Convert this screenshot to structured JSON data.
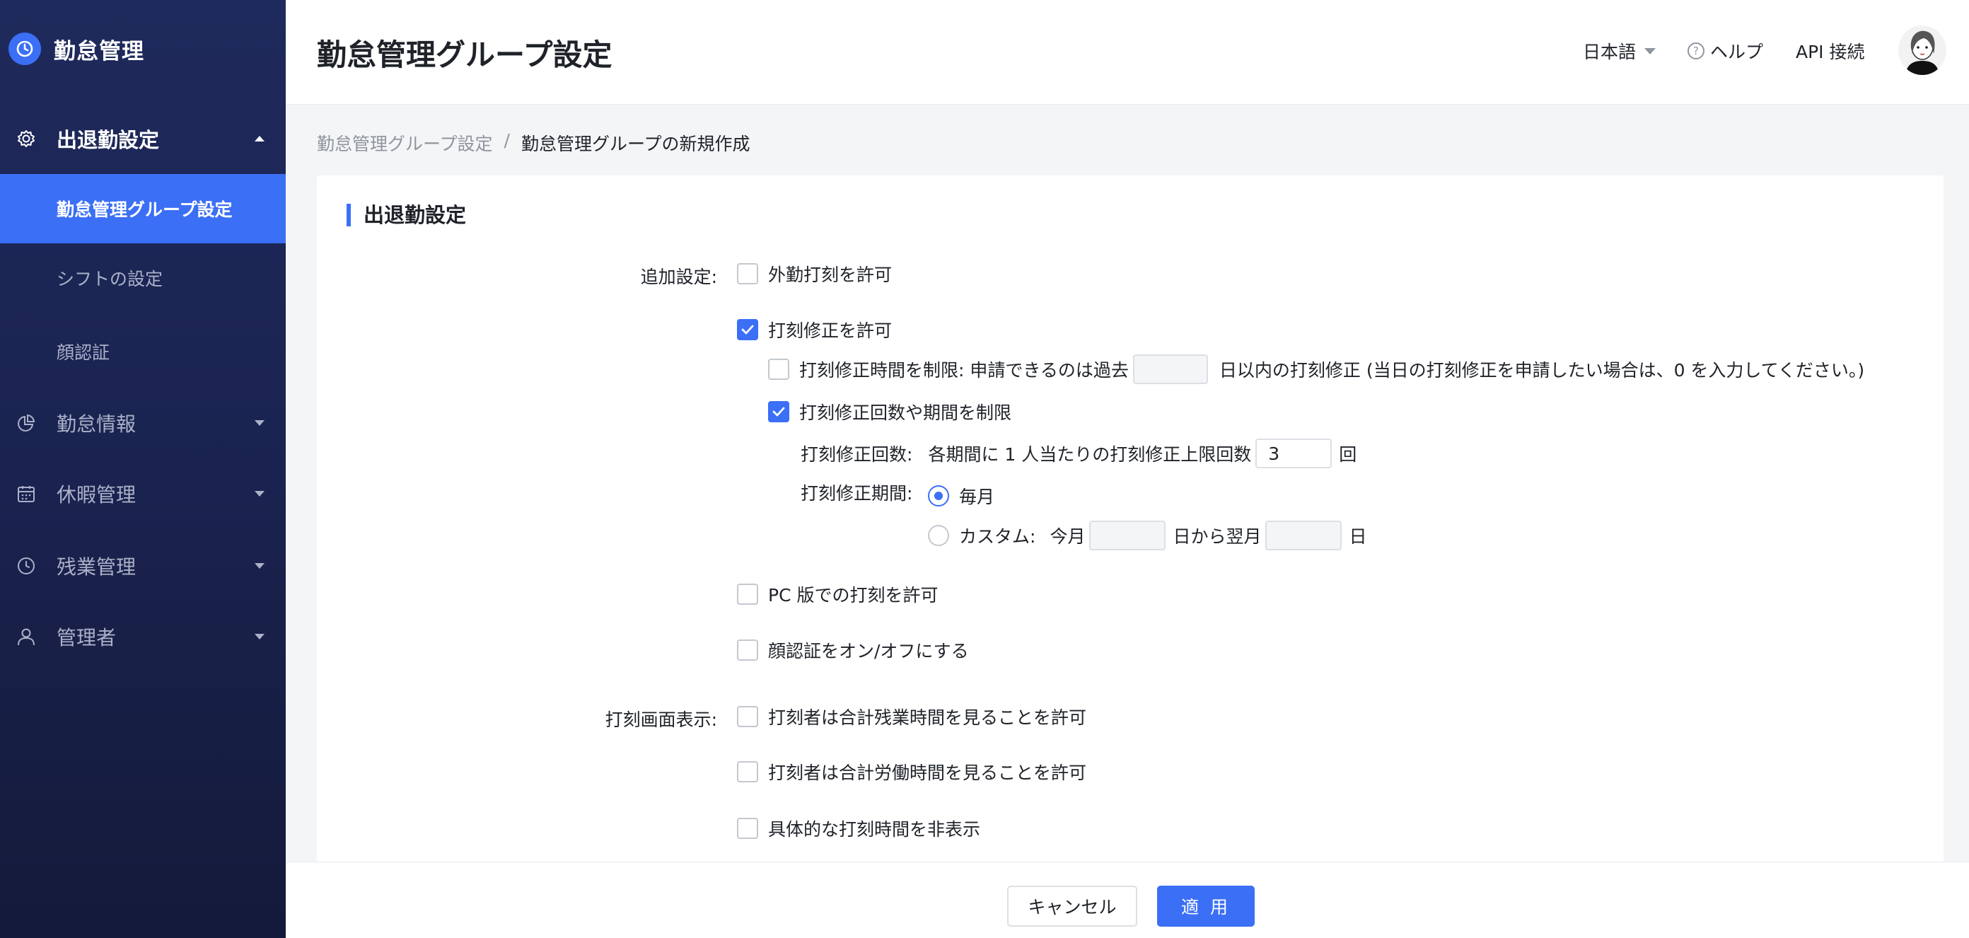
{
  "app": {
    "title": "勤怠管理"
  },
  "sidebar": {
    "groups": [
      {
        "label": "出退勤設定",
        "icon": "gear-icon",
        "open": true,
        "children": [
          "勤怠管理グループ設定",
          "シフトの設定",
          "顔認証"
        ]
      },
      {
        "label": "勤怠情報",
        "icon": "pie-chart-icon"
      },
      {
        "label": "休暇管理",
        "icon": "calendar-icon"
      },
      {
        "label": "残業管理",
        "icon": "clock-icon"
      },
      {
        "label": "管理者",
        "icon": "user-icon"
      }
    ],
    "active_child": "勤怠管理グループ設定"
  },
  "header": {
    "title": "勤怠管理グループ設定",
    "language": "日本語",
    "help": "ヘルプ",
    "api": "API 接続"
  },
  "breadcrumb": {
    "parent": "勤怠管理グループ設定",
    "separator": "/",
    "current": "勤怠管理グループの新規作成"
  },
  "form": {
    "section_title": "出退勤設定",
    "additional_label": "追加設定:",
    "allow_outside_clock": {
      "label": "外勤打刻を許可",
      "checked": false
    },
    "allow_correction": {
      "label": "打刻修正を許可",
      "checked": true
    },
    "limit_correction_time": {
      "label_prefix": "打刻修正時間を制限: 申請できるのは過去",
      "value": "",
      "label_suffix": "日以内の打刻修正 (当日の打刻修正を申請したい場合は、0 を入力してください。)",
      "checked": false
    },
    "limit_correction_count": {
      "label": "打刻修正回数や期間を制限",
      "checked": true
    },
    "correction_count": {
      "label": "打刻修正回数:",
      "text": "各期間に 1 人当たりの打刻修正上限回数",
      "value": "3",
      "unit": "回"
    },
    "correction_period": {
      "label": "打刻修正期間:",
      "monthly": {
        "label": "毎月",
        "selected": true
      },
      "custom": {
        "label": "カスタム:",
        "this_month": "今月",
        "start_value": "",
        "from_next": "日から翌月",
        "end_value": "",
        "day": "日",
        "selected": false
      }
    },
    "allow_pc_clock": {
      "label": "PC 版での打刻を許可",
      "checked": false
    },
    "face_toggle": {
      "label": "顔認証をオン/オフにする",
      "checked": false
    },
    "display_label": "打刻画面表示:",
    "show_overtime": {
      "label": "打刻者は合計残業時間を見ることを許可",
      "checked": false
    },
    "show_worktime": {
      "label": "打刻者は合計労働時間を見ることを許可",
      "checked": false
    },
    "hide_time": {
      "label": "具体的な打刻時間を非表示",
      "checked": false
    }
  },
  "footer": {
    "cancel": "キャンセル",
    "apply": "適 用"
  },
  "colors": {
    "accent": "#3b6ff5",
    "sidebar_bg": "#1f2a5c"
  }
}
